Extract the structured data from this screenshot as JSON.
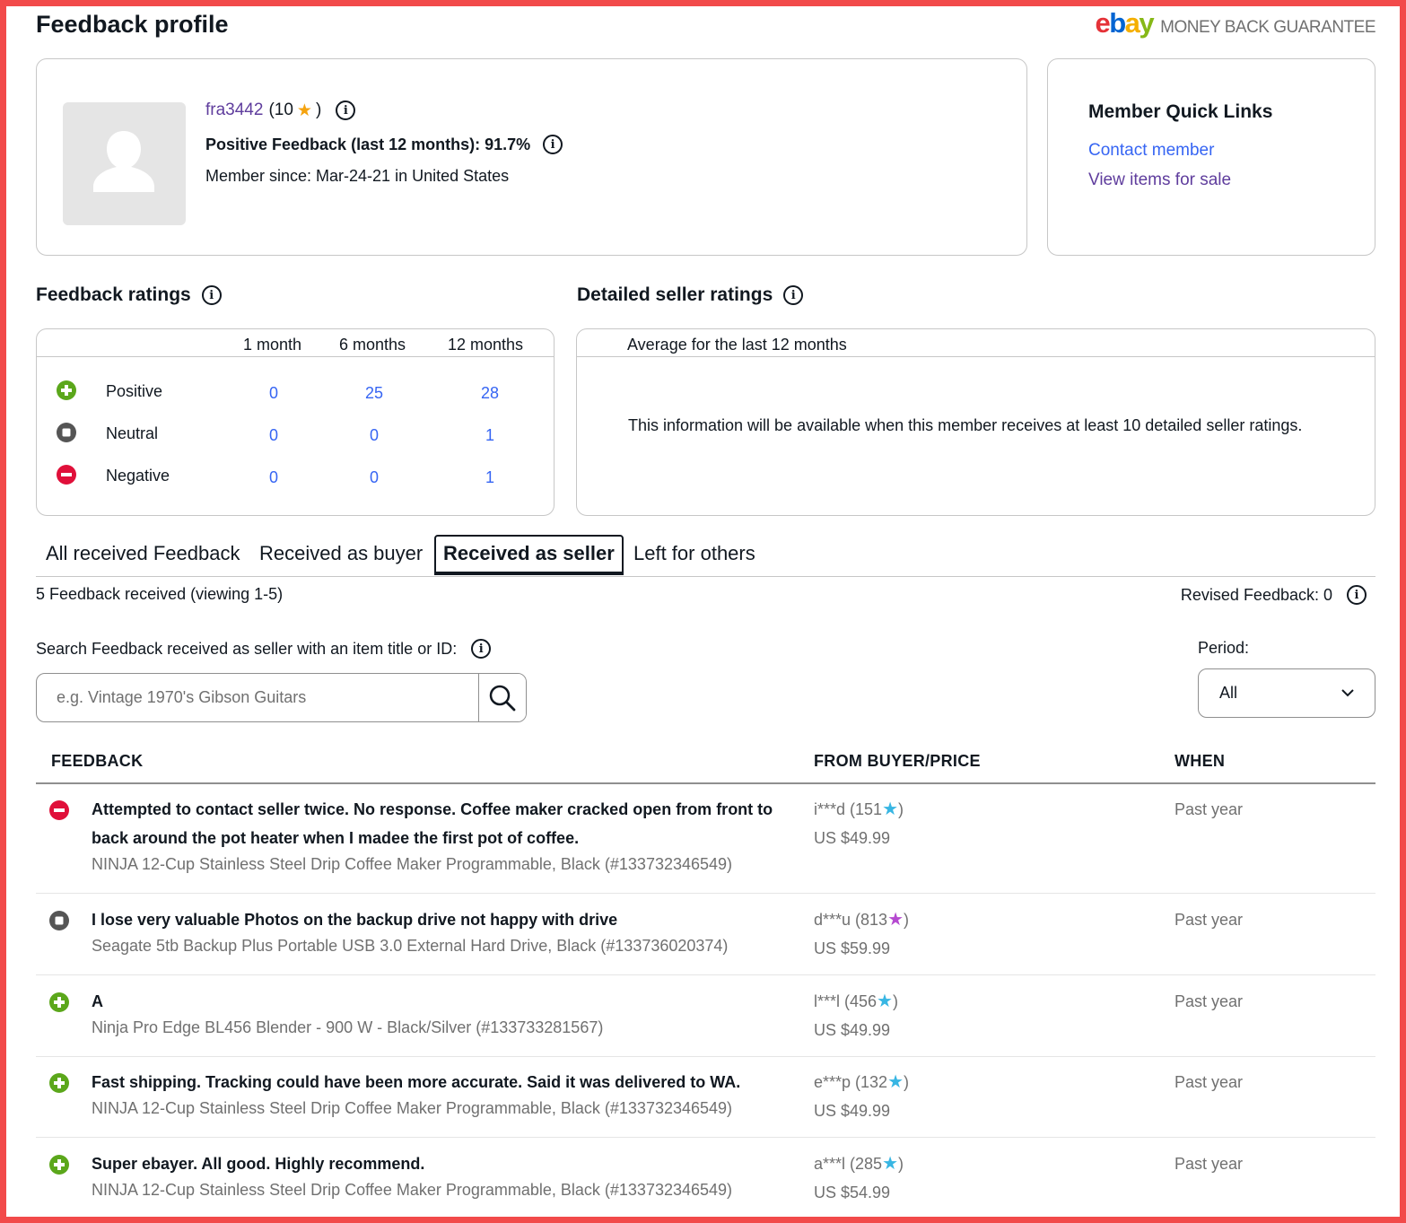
{
  "header": {
    "title": "Feedback profile",
    "logo_letters": [
      "e",
      "b",
      "a",
      "y"
    ],
    "guarantee_text": "MONEY BACK GUARANTEE"
  },
  "profile": {
    "username": "fra3442",
    "score_open": "(10",
    "score_close": ")",
    "positive_feedback": "Positive Feedback (last 12 months): 91.7%",
    "member_since": "Member since: Mar-24-21 in United States"
  },
  "quick_links": {
    "title": "Member Quick Links",
    "contact": "Contact member",
    "view_items": "View items for sale"
  },
  "feedback_ratings": {
    "title": "Feedback ratings",
    "columns": [
      "1 month",
      "6 months",
      "12 months"
    ],
    "rows": [
      {
        "label": "Positive",
        "values": [
          "0",
          "25",
          "28"
        ]
      },
      {
        "label": "Neutral",
        "values": [
          "0",
          "0",
          "1"
        ]
      },
      {
        "label": "Negative",
        "values": [
          "0",
          "0",
          "1"
        ]
      }
    ]
  },
  "detailed_seller_ratings": {
    "title": "Detailed seller ratings",
    "header": "Average for the last 12 months",
    "message": "This information will be available when this member receives at least 10 detailed seller ratings."
  },
  "tabs": [
    {
      "label": "All received Feedback",
      "active": false
    },
    {
      "label": "Received as buyer",
      "active": false
    },
    {
      "label": "Received as seller",
      "active": true
    },
    {
      "label": "Left for others",
      "active": false
    }
  ],
  "count_text": "5 Feedback received (viewing 1-5)",
  "revised_feedback": "Revised Feedback: 0",
  "search": {
    "label": "Search Feedback received as seller with an item title or ID:",
    "placeholder": "e.g. Vintage 1970's Gibson Guitars",
    "value": ""
  },
  "period": {
    "label": "Period:",
    "selected": "All"
  },
  "table": {
    "headers": [
      "FEEDBACK",
      "FROM BUYER/PRICE",
      "WHEN"
    ],
    "rows": [
      {
        "type": "negative",
        "comment": "Attempted to contact seller twice. No response. Coffee maker cracked open from front to back around the pot heater when I madee the first pot of coffee.",
        "item": "NINJA 12-Cup Stainless Steel Drip Coffee Maker Programmable, Black (#133732346549)",
        "buyer": "i***d (151",
        "buyer_close": ")",
        "star_color": "blue",
        "price": "US $49.99",
        "when": "Past year"
      },
      {
        "type": "neutral",
        "comment": "I lose very valuable Photos on the backup drive not happy with drive",
        "item": "Seagate 5tb Backup Plus Portable USB 3.0 External Hard Drive, Black (#133736020374)",
        "buyer": "d***u (813",
        "buyer_close": ")",
        "star_color": "purple",
        "price": "US $59.99",
        "when": "Past year"
      },
      {
        "type": "positive",
        "comment": "A",
        "item": "Ninja Pro Edge BL456 Blender - 900 W - Black/Silver (#133733281567)",
        "buyer": "l***l (456",
        "buyer_close": ")",
        "star_color": "blue",
        "price": "US $49.99",
        "when": "Past year"
      },
      {
        "type": "positive",
        "comment": "Fast shipping. Tracking could have been more accurate. Said it was delivered to WA.",
        "item": "NINJA 12-Cup Stainless Steel Drip Coffee Maker Programmable, Black (#133732346549)",
        "buyer": "e***p (132",
        "buyer_close": ")",
        "star_color": "blue",
        "price": "US $49.99",
        "when": "Past year"
      },
      {
        "type": "positive",
        "comment": "Super ebayer. All good. Highly recommend.",
        "item": "NINJA 12-Cup Stainless Steel Drip Coffee Maker Programmable, Black (#133732346549)",
        "buyer": "a***l (285",
        "buyer_close": ")",
        "star_color": "blue",
        "price": "US $54.99",
        "when": "Past year"
      }
    ]
  },
  "colors": {
    "positive": "#5ba71b",
    "neutral": "#555555",
    "negative": "#e0103a",
    "link": "#3665f3",
    "visited_link": "#5f3d9d",
    "frame": "#f24a4a"
  }
}
